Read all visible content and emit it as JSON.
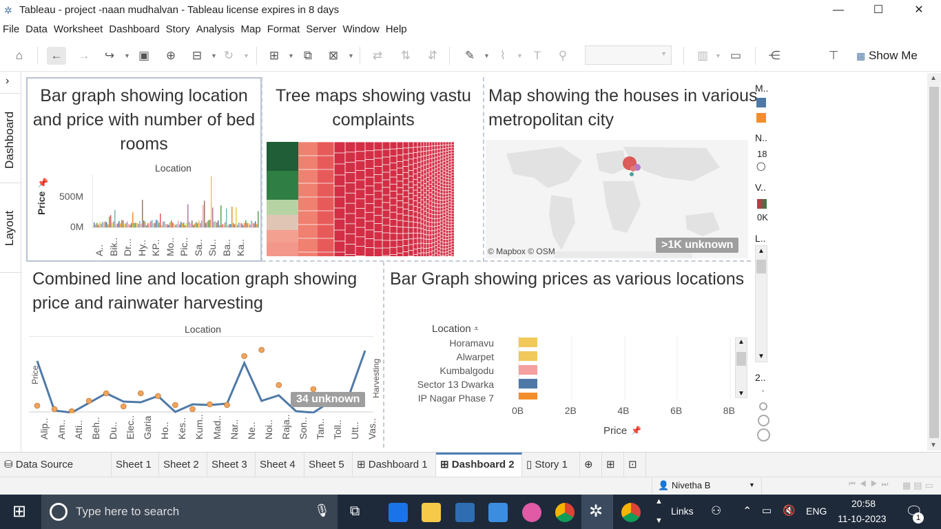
{
  "window": {
    "title": "Tableau - project -naan mudhalvan - Tableau license expires in 8 days",
    "controls": [
      "—",
      "☐",
      "✕"
    ]
  },
  "menu": [
    "File",
    "Data",
    "Worksheet",
    "Dashboard",
    "Story",
    "Analysis",
    "Map",
    "Format",
    "Server",
    "Window",
    "Help"
  ],
  "toolbar": {
    "show_me": "Show Me"
  },
  "side_tabs": {
    "dashboard": "Dashboard",
    "layout": "Layout"
  },
  "zones": {
    "bar1": {
      "title": "Bar graph showing location and price with number of bed rooms",
      "header": "Location",
      "y_label": "Price",
      "y_ticks": [
        "500M",
        "0M"
      ],
      "x_ticks": [
        "A..",
        "Bik..",
        "Dr...",
        "Hy..",
        "KP..",
        "Mo..",
        "Pic..",
        "Sa..",
        "Su..",
        "Ba..",
        "Ka.."
      ]
    },
    "tree": {
      "title": "Tree maps showing vastu complaints"
    },
    "map": {
      "title": "Map showing the houses in various metropolitan city",
      "attribution": "© Mapbox © OSM",
      "unknown": ">1K unknown"
    },
    "line": {
      "title": "Combined line and location graph showing price and rainwater harvesting",
      "header": "Location",
      "y_left": "Price",
      "y_right": "Harvesting",
      "unknown": "34 unknown",
      "x_ticks": [
        "Alip..",
        "Am..",
        "Atti..",
        "Beh..",
        "Du..",
        "Elec..",
        "Garia",
        "Ho..",
        "Kes..",
        "Kum..",
        "Mad..",
        "Nar..",
        "Ne..",
        "Noi..",
        "Raja..",
        "Son..",
        "Tan..",
        "Toll..",
        "Utt..",
        "Vas.."
      ]
    },
    "bar2": {
      "title": "Bar Graph showing prices as various locations",
      "header": "Location",
      "rows": [
        "Horamavu",
        "Alwarpet",
        "Kumbalgodu",
        "Sector 13 Dwarka",
        "IP Nagar Phase 7"
      ],
      "x_ticks": [
        "0B",
        "2B",
        "4B",
        "6B",
        "8B"
      ],
      "x_label": "Price"
    }
  },
  "legend": {
    "m": "M..",
    "n": "N..",
    "n_val": "18",
    "v": "V..",
    "v_val": "0K",
    "l": "L..",
    "two": "2.."
  },
  "tabs": [
    "Data Source",
    "Sheet 1",
    "Sheet 2",
    "Sheet 3",
    "Sheet 4",
    "Sheet 5",
    "Dashboard 1",
    "Dashboard 2",
    "Story 1"
  ],
  "status": {
    "user": "Nivetha B"
  },
  "taskbar": {
    "search_placeholder": "Type here to search",
    "links": "Links",
    "lang": "ENG",
    "time": "20:58",
    "date": "11-10-2023",
    "notif": "1"
  },
  "colors": {
    "blue": "#4e79a7",
    "orange": "#f28e2b",
    "red": "#d62d45",
    "green": "#2e7d43",
    "gray": "#9e9e9e"
  }
}
